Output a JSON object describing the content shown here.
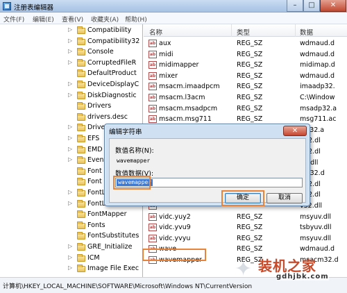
{
  "window": {
    "title": "注册表编辑器",
    "min_label": "–",
    "max_label": "□",
    "close_label": "✕"
  },
  "menu": [
    "文件(F)",
    "编辑(E)",
    "查看(V)",
    "收藏夹(A)",
    "帮助(H)"
  ],
  "tree": {
    "items": [
      {
        "label": "Compatibility",
        "expandable": true
      },
      {
        "label": "Compatibility32",
        "expandable": true
      },
      {
        "label": "Console",
        "expandable": true
      },
      {
        "label": "CorruptedFileR",
        "expandable": true
      },
      {
        "label": "DefaultProduct",
        "expandable": false
      },
      {
        "label": "DeviceDisplayC",
        "expandable": true
      },
      {
        "label": "DiskDiagnostic",
        "expandable": true
      },
      {
        "label": "Drivers",
        "expandable": false
      },
      {
        "label": "drivers.desc",
        "expandable": false
      },
      {
        "label": "Drive",
        "expandable": true
      },
      {
        "label": "EFS",
        "expandable": true
      },
      {
        "label": "EMD",
        "expandable": true
      },
      {
        "label": "Event",
        "expandable": true
      },
      {
        "label": "Font",
        "expandable": false
      },
      {
        "label": "Font",
        "expandable": false
      },
      {
        "label": "FontL",
        "expandable": true
      },
      {
        "label": "FontL",
        "expandable": true
      },
      {
        "label": "FontMapper",
        "expandable": false
      },
      {
        "label": "Fonts",
        "expandable": false
      },
      {
        "label": "FontSubstitutes",
        "expandable": false
      },
      {
        "label": "GRE_Initialize",
        "expandable": true
      },
      {
        "label": "ICM",
        "expandable": true
      },
      {
        "label": "Image File Exec",
        "expandable": true
      }
    ]
  },
  "list": {
    "columns": [
      "名称",
      "类型",
      "数据"
    ],
    "rows": [
      {
        "name": "aux",
        "type": "REG_SZ",
        "data": "wdmaud.d"
      },
      {
        "name": "midi",
        "type": "REG_SZ",
        "data": "wdmaud.d"
      },
      {
        "name": "midimapper",
        "type": "REG_SZ",
        "data": "midimap.d"
      },
      {
        "name": "mixer",
        "type": "REG_SZ",
        "data": "wdmaud.d"
      },
      {
        "name": "msacm.imaadpcm",
        "type": "REG_SZ",
        "data": "imaadp32."
      },
      {
        "name": "msacm.l3acm",
        "type": "REG_SZ",
        "data": "C:\\Window"
      },
      {
        "name": "msacm.msadpcm",
        "type": "REG_SZ",
        "data": "msadp32.a"
      },
      {
        "name": "msacm.msg711",
        "type": "REG_SZ",
        "data": "msg711.ac"
      },
      {
        "name": "",
        "type": "",
        "data": "sm32.a"
      },
      {
        "name": "",
        "type": "",
        "data": "d32.dl"
      },
      {
        "name": "",
        "type": "",
        "data": "d32.dl"
      },
      {
        "name": "",
        "type": "",
        "data": "32.dll"
      },
      {
        "name": "",
        "type": "",
        "data": "fdc32.d"
      },
      {
        "name": "",
        "type": "",
        "data": "d32.dl"
      },
      {
        "name": "",
        "type": "",
        "data": "d32.dl"
      },
      {
        "name": "",
        "type": "",
        "data": "v32.dll"
      },
      {
        "name": "vidc.yuy2",
        "type": "REG_SZ",
        "data": "msyuv.dll"
      },
      {
        "name": "vidc.yvu9",
        "type": "REG_SZ",
        "data": "tsbyuv.dll"
      },
      {
        "name": "vidc.yvyu",
        "type": "REG_SZ",
        "data": "msyuv.dll"
      },
      {
        "name": "wave",
        "type": "REG_SZ",
        "data": "wdmaud.d"
      },
      {
        "name": "wavemapper",
        "type": "REG_SZ",
        "data": "msacm32.d"
      }
    ]
  },
  "statusbar": {
    "path": "计算机\\HKEY_LOCAL_MACHINE\\SOFTWARE\\Microsoft\\Windows NT\\CurrentVersion"
  },
  "dialog": {
    "title": "编辑字符串",
    "close_label": "✕",
    "name_label": "数值名称(N):",
    "name_value": "wavemapper",
    "data_label": "数值数据(V):",
    "data_value": "wavemapper",
    "ok_label": "确定",
    "cancel_label": "取消"
  },
  "watermark": {
    "title": "装机之家",
    "url": "gdhjbk.com"
  },
  "colors": {
    "highlight": "#e8843a",
    "selection": "#3a78d8"
  }
}
